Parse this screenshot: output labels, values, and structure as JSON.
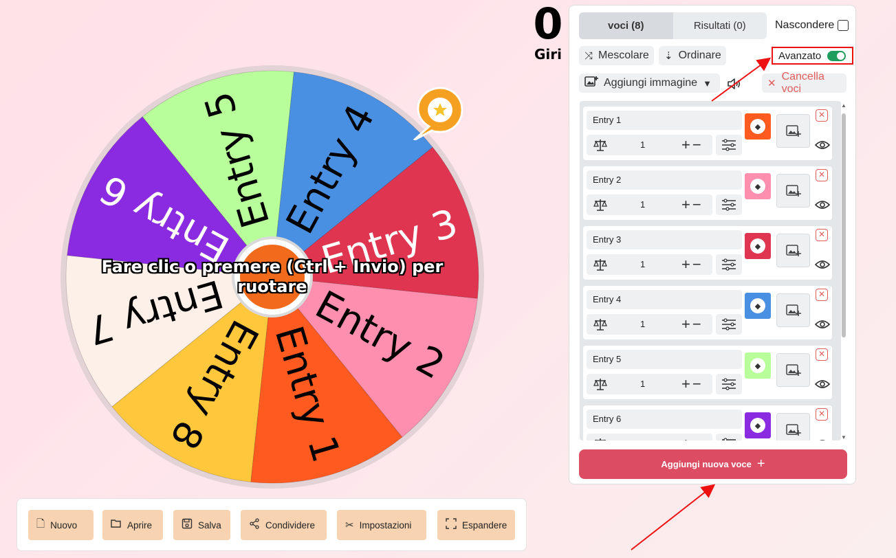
{
  "wheel": {
    "spin_prompt_line1": "Fare clic o premere (Ctrl + Invio) per",
    "spin_prompt_line2": "ruotare",
    "segments": [
      {
        "label": "Entry 4",
        "color": "#4a90e2",
        "text_color": "#000000"
      },
      {
        "label": "Entry 3",
        "color": "#e03551",
        "text_color": "#ffffff"
      },
      {
        "label": "Entry 2",
        "color": "#ff8fae",
        "text_color": "#000000"
      },
      {
        "label": "Entry 1",
        "color": "#ff5a1f",
        "text_color": "#000000"
      },
      {
        "label": "Entry 8",
        "color": "#ffc83c",
        "text_color": "#000000"
      },
      {
        "label": "Entry 7",
        "color": "#fcf0e8",
        "text_color": "#000000"
      },
      {
        "label": "Entry 6",
        "color": "#8a2be2",
        "text_color": "#ffffff"
      },
      {
        "label": "Entry 5",
        "color": "#b8fe9a",
        "text_color": "#000000"
      }
    ]
  },
  "counter": {
    "value": "0",
    "label": "Giri"
  },
  "panel": {
    "tab_entries": "voci (8)",
    "tab_results": "Risultati (0)",
    "hide_label": "Nascondere",
    "shuffle_label": "Mescolare",
    "sort_label": "Ordinare",
    "advanced_label": "Avanzato",
    "add_image_label": "Aggiungi immagine",
    "clear_label": "Cancella voci",
    "add_entry_label": "Aggiungi nuova voce"
  },
  "entries": [
    {
      "name": "Entry 1",
      "weight": "1",
      "color": "#ff5a1f"
    },
    {
      "name": "Entry 2",
      "weight": "1",
      "color": "#ff8fae"
    },
    {
      "name": "Entry 3",
      "weight": "1",
      "color": "#e03551"
    },
    {
      "name": "Entry 4",
      "weight": "1",
      "color": "#4a90e2"
    },
    {
      "name": "Entry 5",
      "weight": "1",
      "color": "#b8fe9a"
    },
    {
      "name": "Entry 6",
      "weight": "1",
      "color": "#8a2be2"
    }
  ],
  "toolbar": {
    "new_label": "Nuovo",
    "open_label": "Aprire",
    "save_label": "Salva",
    "share_label": "Condividere",
    "settings_label": "Impostazioni",
    "expand_label": "Espandere"
  },
  "colors": {
    "accent": "#dc4d63",
    "toggle_on": "#1f9d5c",
    "toolbar_button": "#f7d3b2"
  }
}
